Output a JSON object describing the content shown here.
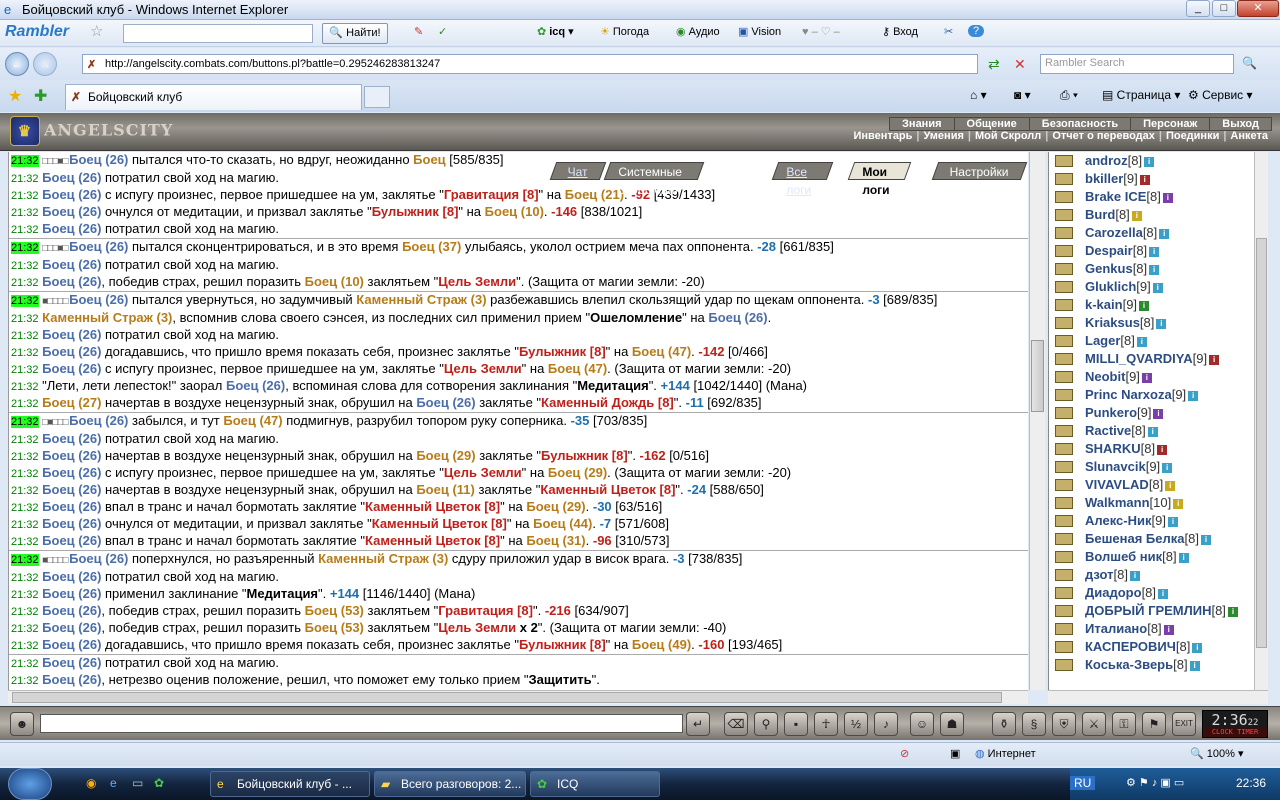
{
  "window": {
    "title": "Бойцовский клуб - Windows Internet Explorer"
  },
  "rambler": {
    "logo": "Rambler",
    "find": "Найти!",
    "items": [
      "icq",
      "Погода",
      "Аудио",
      "Vision",
      "Вход"
    ]
  },
  "address": {
    "url": "http://angelscity.combats.com/buttons.pl?battle=0.295246283813247",
    "search_placeholder": "Rambler Search"
  },
  "tabs": {
    "title": "Бойцовский клуб",
    "page": "Страница",
    "service": "Сервис"
  },
  "game": {
    "logo": "ANGELSCITY",
    "menu_top": [
      "Знания",
      "Общение",
      "Безопасность",
      "Персонаж",
      "Выход"
    ],
    "menu_bottom": [
      "Инвентарь",
      "Умения",
      "Мой Скролл",
      "Отчет о переводах",
      "Поединки",
      "Анкета"
    ],
    "chat_tabs": [
      "Чат",
      "Системные сообщения",
      "Все логи",
      "Мои логи",
      "Настройки"
    ]
  },
  "log": [
    {
      "t": "21:32",
      "hl": true,
      "parts": [
        [
          "boxes",
          "□□□■□ "
        ],
        [
          "pb",
          "Боец (26)"
        ],
        [
          "n",
          " пытался что-то сказать, но вдруг, неожиданно "
        ],
        [
          "po",
          "Боец"
        ],
        [
          "n",
          " [585/835]"
        ]
      ]
    },
    {
      "t": "21:32",
      "parts": [
        [
          "pb",
          "Боец (26)"
        ],
        [
          "n",
          " потратил свой ход на магию."
        ]
      ]
    },
    {
      "t": "21:32",
      "parts": [
        [
          "pb",
          "Боец (26)"
        ],
        [
          "n",
          " с испугу произнес, первое пришедшее на ум, заклятье \""
        ],
        [
          "spell",
          "Гравитация [8]"
        ],
        [
          "n",
          "\" на "
        ],
        [
          "po",
          "Боец (21)"
        ],
        [
          "n",
          ". "
        ],
        [
          "dmg",
          "-92"
        ],
        [
          "n",
          " [439/1433]"
        ]
      ]
    },
    {
      "t": "21:32",
      "parts": [
        [
          "pb",
          "Боец (26)"
        ],
        [
          "n",
          " очнулся от медитации, и призвал заклятье \""
        ],
        [
          "spell",
          "Булыжник [8]"
        ],
        [
          "n",
          "\" на "
        ],
        [
          "po",
          "Боец (10)"
        ],
        [
          "n",
          ". "
        ],
        [
          "dmg",
          "-146"
        ],
        [
          "n",
          " [838/1021]"
        ]
      ]
    },
    {
      "t": "21:32",
      "parts": [
        [
          "pb",
          "Боец (26)"
        ],
        [
          "n",
          " потратил свой ход на магию."
        ]
      ]
    },
    {
      "t": "21:32",
      "hl": true,
      "sep": true,
      "parts": [
        [
          "boxes",
          "□□□■□ "
        ],
        [
          "pb",
          "Боец (26)"
        ],
        [
          "n",
          " пытался сконцентрироваться, и в это время "
        ],
        [
          "po",
          "Боец (37)"
        ],
        [
          "n",
          " улыбаясь, уколол острием меча пах оппонента. "
        ],
        [
          "heal",
          "-28"
        ],
        [
          "n",
          " [661/835]"
        ]
      ]
    },
    {
      "t": "21:32",
      "parts": [
        [
          "pb",
          "Боец (26)"
        ],
        [
          "n",
          " потратил свой ход на магию."
        ]
      ]
    },
    {
      "t": "21:32",
      "parts": [
        [
          "pb",
          "Боец (26)"
        ],
        [
          "n",
          ", победив страх, решил поразить "
        ],
        [
          "po",
          "Боец (10)"
        ],
        [
          "n",
          " заклятьем \""
        ],
        [
          "spell",
          "Цель Земли"
        ],
        [
          "n",
          "\". (Защита от магии земли: -20)"
        ]
      ]
    },
    {
      "t": "21:32",
      "hl": true,
      "sep": true,
      "wrap": true,
      "parts": [
        [
          "boxes",
          "■□□□□ "
        ],
        [
          "pb",
          "Боец (26)"
        ],
        [
          "n",
          " пытался увернуться, но задумчивый "
        ],
        [
          "po",
          "Каменный Страж (3)"
        ],
        [
          "n",
          " разбежавшись влепил скользящий удар по щекам оппонента. "
        ],
        [
          "heal",
          "-3"
        ],
        [
          "n",
          " [689/835]"
        ]
      ]
    },
    {
      "t": "21:32",
      "parts": [
        [
          "po",
          "Каменный Страж (3)"
        ],
        [
          "n",
          ", вспомнив слова своего сэнсея, из последних сил применил прием \""
        ],
        [
          "b",
          "Ошеломление"
        ],
        [
          "n",
          "\" на "
        ],
        [
          "pb",
          "Боец (26)"
        ],
        [
          "n",
          "."
        ]
      ]
    },
    {
      "t": "21:32",
      "parts": [
        [
          "pb",
          "Боец (26)"
        ],
        [
          "n",
          " потратил свой ход на магию."
        ]
      ]
    },
    {
      "t": "21:32",
      "parts": [
        [
          "pb",
          "Боец (26)"
        ],
        [
          "n",
          " догадавшись, что пришло время показать себя, произнес заклятье \""
        ],
        [
          "spell",
          "Булыжник [8]"
        ],
        [
          "n",
          "\" на "
        ],
        [
          "po",
          "Боец (47)"
        ],
        [
          "n",
          ". "
        ],
        [
          "dmg",
          "-142"
        ],
        [
          "n",
          " [0/466]"
        ]
      ]
    },
    {
      "t": "21:32",
      "parts": [
        [
          "pb",
          "Боец (26)"
        ],
        [
          "n",
          " с испугу произнес, первое пришедшее на ум, заклятье \""
        ],
        [
          "spell",
          "Цель Земли"
        ],
        [
          "n",
          "\" на "
        ],
        [
          "po",
          "Боец (47)"
        ],
        [
          "n",
          ". (Защита от магии земли: -20)"
        ]
      ]
    },
    {
      "t": "21:32",
      "parts": [
        [
          "n",
          "\"Лети, лети лепесток!\" заорал "
        ],
        [
          "pb",
          "Боец (26)"
        ],
        [
          "n",
          ", вспоминая слова для сотворения заклинания \""
        ],
        [
          "b",
          "Медитация"
        ],
        [
          "n",
          "\". "
        ],
        [
          "heal",
          "+144"
        ],
        [
          "n",
          " [1042/1440] (Мана)"
        ]
      ]
    },
    {
      "t": "21:32",
      "parts": [
        [
          "po",
          "Боец (27)"
        ],
        [
          "n",
          " начертав в воздухе нецензурный знак, обрушил на "
        ],
        [
          "pb",
          "Боец (26)"
        ],
        [
          "n",
          " заклятье \""
        ],
        [
          "spell",
          "Каменный Дождь [8]"
        ],
        [
          "n",
          "\". "
        ],
        [
          "heal",
          "-11"
        ],
        [
          "n",
          " [692/835]"
        ]
      ]
    },
    {
      "t": "21:32",
      "hl": true,
      "sep": true,
      "parts": [
        [
          "boxes",
          "□■□□□ "
        ],
        [
          "pb",
          "Боец (26)"
        ],
        [
          "n",
          " забылся, и тут "
        ],
        [
          "po",
          "Боец (47)"
        ],
        [
          "n",
          " подмигнув, разрубил топором руку соперника. "
        ],
        [
          "heal",
          "-35"
        ],
        [
          "n",
          " [703/835]"
        ]
      ]
    },
    {
      "t": "21:32",
      "parts": [
        [
          "pb",
          "Боец (26)"
        ],
        [
          "n",
          " потратил свой ход на магию."
        ]
      ]
    },
    {
      "t": "21:32",
      "parts": [
        [
          "pb",
          "Боец (26)"
        ],
        [
          "n",
          " начертав в воздухе нецензурный знак, обрушил на "
        ],
        [
          "po",
          "Боец (29)"
        ],
        [
          "n",
          " заклятье \""
        ],
        [
          "spell",
          "Булыжник [8]"
        ],
        [
          "n",
          "\". "
        ],
        [
          "dmg",
          "-162"
        ],
        [
          "n",
          " [0/516]"
        ]
      ]
    },
    {
      "t": "21:32",
      "parts": [
        [
          "pb",
          "Боец (26)"
        ],
        [
          "n",
          " с испугу произнес, первое пришедшее на ум, заклятье \""
        ],
        [
          "spell",
          "Цель Земли"
        ],
        [
          "n",
          "\" на "
        ],
        [
          "po",
          "Боец (29)"
        ],
        [
          "n",
          ". (Защита от магии земли: -20)"
        ]
      ]
    },
    {
      "t": "21:32",
      "parts": [
        [
          "pb",
          "Боец (26)"
        ],
        [
          "n",
          " начертав в воздухе нецензурный знак, обрушил на "
        ],
        [
          "po",
          "Боец (11)"
        ],
        [
          "n",
          " заклятье \""
        ],
        [
          "spell",
          "Каменный Цветок [8]"
        ],
        [
          "n",
          "\". "
        ],
        [
          "heal",
          "-24"
        ],
        [
          "n",
          " [588/650]"
        ]
      ]
    },
    {
      "t": "21:32",
      "parts": [
        [
          "pb",
          "Боец (26)"
        ],
        [
          "n",
          " впал в транс и начал бормотать заклятие \""
        ],
        [
          "spell",
          "Каменный Цветок [8]"
        ],
        [
          "n",
          "\" на "
        ],
        [
          "po",
          "Боец (29)"
        ],
        [
          "n",
          ". "
        ],
        [
          "heal",
          "-30"
        ],
        [
          "n",
          " [63/516]"
        ]
      ]
    },
    {
      "t": "21:32",
      "parts": [
        [
          "pb",
          "Боец (26)"
        ],
        [
          "n",
          " очнулся от медитации, и призвал заклятье \""
        ],
        [
          "spell",
          "Каменный Цветок [8]"
        ],
        [
          "n",
          "\" на "
        ],
        [
          "po",
          "Боец (44)"
        ],
        [
          "n",
          ". "
        ],
        [
          "heal",
          "-7"
        ],
        [
          "n",
          " [571/608]"
        ]
      ]
    },
    {
      "t": "21:32",
      "parts": [
        [
          "pb",
          "Боец (26)"
        ],
        [
          "n",
          " впал в транс и начал бормотать заклятие \""
        ],
        [
          "spell",
          "Каменный Цветок [8]"
        ],
        [
          "n",
          "\" на "
        ],
        [
          "po",
          "Боец (31)"
        ],
        [
          "n",
          ". "
        ],
        [
          "dmg",
          "-96"
        ],
        [
          "n",
          " [310/573]"
        ]
      ]
    },
    {
      "t": "21:32",
      "hl": true,
      "sep": true,
      "parts": [
        [
          "boxes",
          "■□□□□ "
        ],
        [
          "pb",
          "Боец (26)"
        ],
        [
          "n",
          " поперхнулся, но разъяренный "
        ],
        [
          "po",
          "Каменный Страж (3)"
        ],
        [
          "n",
          " сдуру приложил удар в висок врага. "
        ],
        [
          "heal",
          "-3"
        ],
        [
          "n",
          " [738/835]"
        ]
      ]
    },
    {
      "t": "21:32",
      "parts": [
        [
          "pb",
          "Боец (26)"
        ],
        [
          "n",
          " потратил свой ход на магию."
        ]
      ]
    },
    {
      "t": "21:32",
      "parts": [
        [
          "pb",
          "Боец (26)"
        ],
        [
          "n",
          " применил заклинание \""
        ],
        [
          "b",
          "Медитация"
        ],
        [
          "n",
          "\". "
        ],
        [
          "heal",
          "+144"
        ],
        [
          "n",
          " [1146/1440] (Мана)"
        ]
      ]
    },
    {
      "t": "21:32",
      "parts": [
        [
          "pb",
          "Боец (26)"
        ],
        [
          "n",
          ", победив страх, решил поразить "
        ],
        [
          "po",
          "Боец (53)"
        ],
        [
          "n",
          " заклятьем \""
        ],
        [
          "spell",
          "Гравитация [8]"
        ],
        [
          "n",
          "\". "
        ],
        [
          "dmg",
          "-216"
        ],
        [
          "n",
          " [634/907]"
        ]
      ]
    },
    {
      "t": "21:32",
      "parts": [
        [
          "pb",
          "Боец (26)"
        ],
        [
          "n",
          ", победив страх, решил поразить "
        ],
        [
          "po",
          "Боец (53)"
        ],
        [
          "n",
          " заклятьем \""
        ],
        [
          "spell",
          "Цель Земли"
        ],
        [
          "b",
          " x 2"
        ],
        [
          "n",
          "\". (Защита от магии земли: -40)"
        ]
      ]
    },
    {
      "t": "21:32",
      "parts": [
        [
          "pb",
          "Боец (26)"
        ],
        [
          "n",
          " догадавшись, что пришло время показать себя, произнес заклятье \""
        ],
        [
          "spell",
          "Булыжник [8]"
        ],
        [
          "n",
          "\" на "
        ],
        [
          "po",
          "Боец (49)"
        ],
        [
          "n",
          ". "
        ],
        [
          "dmg",
          "-160"
        ],
        [
          "n",
          " [193/465]"
        ]
      ]
    },
    {
      "t": "21:32",
      "sep": true,
      "parts": [
        [
          "pb",
          "Боец (26)"
        ],
        [
          "n",
          " потратил свой ход на магию."
        ]
      ]
    },
    {
      "t": "21:32",
      "parts": [
        [
          "pb",
          "Боец (26)"
        ],
        [
          "n",
          ", нетрезво оценив положение, решил, что поможет ему только прием \""
        ],
        [
          "b",
          "Защитить"
        ],
        [
          "n",
          "\"."
        ]
      ]
    }
  ],
  "users": [
    {
      "name": "androz",
      "lv": "[8]",
      "inf": ""
    },
    {
      "name": "bkiller",
      "lv": "[9]",
      "inf": "r"
    },
    {
      "name": "Brake ICE",
      "lv": "[8]",
      "inf": "p"
    },
    {
      "name": "Burd",
      "lv": "[8]",
      "inf": "y"
    },
    {
      "name": "Carozella",
      "lv": "[8]",
      "inf": ""
    },
    {
      "name": "Despair",
      "lv": "[8]",
      "inf": ""
    },
    {
      "name": "Genkus",
      "lv": "[8]",
      "inf": ""
    },
    {
      "name": "Gluklich",
      "lv": "[9]",
      "inf": ""
    },
    {
      "name": "k-kain",
      "lv": "[9]",
      "inf": "g"
    },
    {
      "name": "Kriaksus",
      "lv": "[8]",
      "inf": ""
    },
    {
      "name": "Lager",
      "lv": "[8]",
      "inf": ""
    },
    {
      "name": "MILLI_QVARDIYA",
      "lv": "[9]",
      "inf": "r"
    },
    {
      "name": "Neobit",
      "lv": "[9]",
      "inf": "p"
    },
    {
      "name": "Princ Narxoza",
      "lv": "[9]",
      "inf": ""
    },
    {
      "name": "Punkero",
      "lv": "[9]",
      "inf": "p"
    },
    {
      "name": "Ractive",
      "lv": "[8]",
      "inf": ""
    },
    {
      "name": "SHARKU",
      "lv": "[8]",
      "inf": "r"
    },
    {
      "name": "Slunavcik",
      "lv": "[9]",
      "inf": ""
    },
    {
      "name": "VIVAVLAD",
      "lv": "[8]",
      "inf": "y"
    },
    {
      "name": "Walkmann",
      "lv": "[10]",
      "inf": "y"
    },
    {
      "name": "Алекс-Ник",
      "lv": "[9]",
      "inf": ""
    },
    {
      "name": "Бешеная Белка",
      "lv": "[8]",
      "inf": ""
    },
    {
      "name": "Волшеб ник",
      "lv": "[8]",
      "inf": ""
    },
    {
      "name": "дзот",
      "lv": "[8]",
      "inf": ""
    },
    {
      "name": "Диадоро",
      "lv": "[8]",
      "inf": ""
    },
    {
      "name": "ДОБРЫЙ ГРЕМЛИН",
      "lv": "[8]",
      "inf": "g"
    },
    {
      "name": "Италиано",
      "lv": "[8]",
      "inf": "p"
    },
    {
      "name": "КАСПЕРОВИЧ",
      "lv": "[8]",
      "inf": ""
    },
    {
      "name": "Коська-Зверь",
      "lv": "[8]",
      "inf": ""
    }
  ],
  "clock": {
    "time": "2:36",
    "seconds": "22",
    "label": "CLOCK  TIMER"
  },
  "status": {
    "zone": "Интернет",
    "zoom": "100%"
  },
  "taskbar": {
    "tasks": [
      "Бойцовский клуб - ...",
      "Всего разговоров: 2...",
      "ICQ"
    ],
    "lang": "RU",
    "time": "22:36"
  }
}
